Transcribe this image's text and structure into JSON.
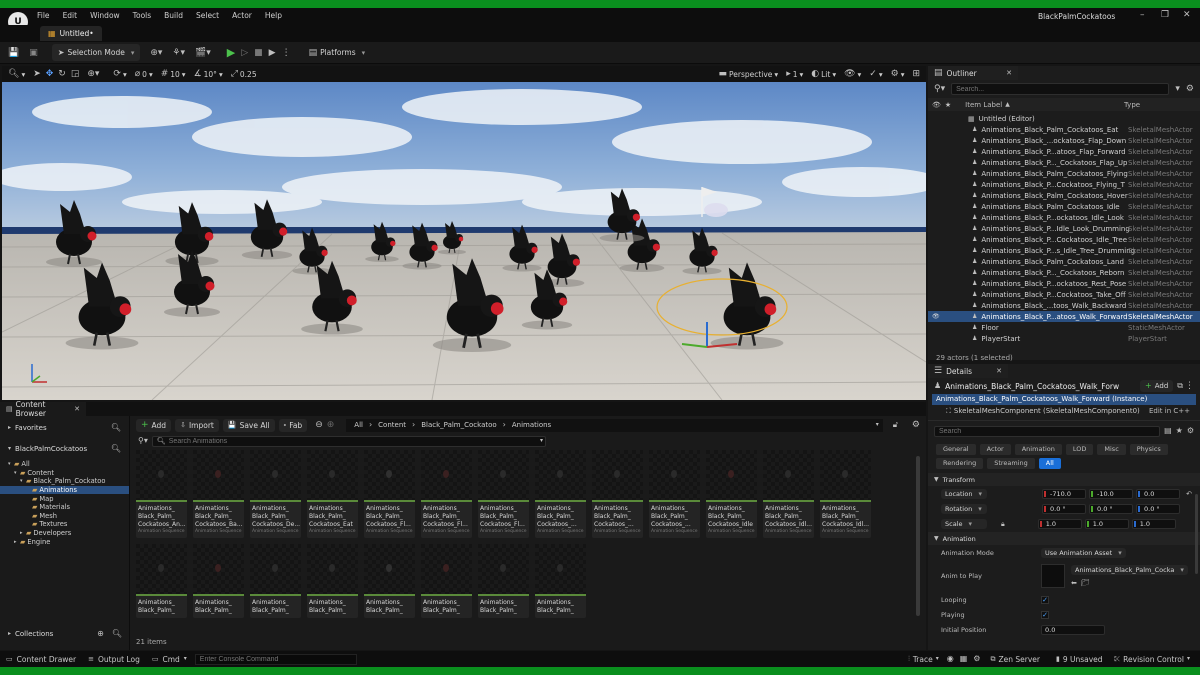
{
  "app": {
    "project_name": "BlackPalmCockatoos",
    "tab_label": "Untitled•"
  },
  "menu": [
    "File",
    "Edit",
    "Window",
    "Tools",
    "Build",
    "Select",
    "Actor",
    "Help"
  ],
  "toolbar": {
    "selection_mode": "Selection Mode",
    "platforms": "Platforms"
  },
  "viewport": {
    "perspective": "Perspective",
    "lit": "Lit",
    "view_count": "1",
    "rotation_snap_value": "0",
    "grid_snap": "10",
    "angle_snap": "10°",
    "scale_snap": "0.25"
  },
  "outliner": {
    "title": "Outliner",
    "search_placeholder": "Search...",
    "col_label": "Item Label",
    "col_type": "Type",
    "root": "Untitled (Editor)",
    "items": [
      {
        "label": "Animations_Black_Palm_Cockatoos_Eat",
        "type": "SkeletalMeshActor"
      },
      {
        "label": "Animations_Black_...ockatoos_Flap_Down",
        "type": "SkeletalMeshActor"
      },
      {
        "label": "Animations_Black_P...atoos_Flap_Forward",
        "type": "SkeletalMeshActor"
      },
      {
        "label": "Animations_Black_P..._Cockatoos_Flap_Up",
        "type": "SkeletalMeshActor"
      },
      {
        "label": "Animations_Black_Palm_Cockatoos_Flying",
        "type": "SkeletalMeshActor"
      },
      {
        "label": "Animations_Black_P...Cockatoos_Flying_T",
        "type": "SkeletalMeshActor"
      },
      {
        "label": "Animations_Black_Palm_Cockatoos_Hover",
        "type": "SkeletalMeshActor"
      },
      {
        "label": "Animations_Black_Palm_Cockatoos_Idle",
        "type": "SkeletalMeshActor"
      },
      {
        "label": "Animations_Black_P...ockatoos_Idle_Look",
        "type": "SkeletalMeshActor"
      },
      {
        "label": "Animations_Black_P...Idle_Look_Drumming",
        "type": "SkeletalMeshActor"
      },
      {
        "label": "Animations_Black_P...Cockatoos_Idle_Tree",
        "type": "SkeletalMeshActor"
      },
      {
        "label": "Animations_Black_P...s_Idle_Tree_Drumming",
        "type": "SkeletalMeshActor"
      },
      {
        "label": "Animations_Black_Palm_Cockatoos_Land",
        "type": "SkeletalMeshActor"
      },
      {
        "label": "Animations_Black_P..._Cockatoos_Reborn",
        "type": "SkeletalMeshActor"
      },
      {
        "label": "Animations_Black_P...ockatoos_Rest_Pose",
        "type": "SkeletalMeshActor"
      },
      {
        "label": "Animations_Black_P...Cockatoos_Take_Off",
        "type": "SkeletalMeshActor"
      },
      {
        "label": "Animations_Black_...toos_Walk_Backward",
        "type": "SkeletalMeshActor"
      },
      {
        "label": "Animations_Black_P...atoos_Walk_Forward",
        "type": "SkeletalMeshActor",
        "selected": true
      },
      {
        "label": "Floor",
        "type": "StaticMeshActor"
      },
      {
        "label": "PlayerStart",
        "type": "PlayerStart"
      }
    ],
    "footer": "29 actors (1 selected)"
  },
  "details": {
    "title": "Details",
    "actor_name": "Animations_Black_Palm_Cockatoos_Walk_Forw",
    "add_label": "Add",
    "instance": "Animations_Black_Palm_Cockatoos_Walk_Forward (Instance)",
    "component": "SkeletalMeshComponent (SkeletalMeshComponent0)",
    "edit_cpp": "Edit in C++",
    "search_placeholder": "Search",
    "chips": [
      "General",
      "Actor",
      "Animation",
      "LOD",
      "Misc",
      "Physics",
      "Rendering",
      "Streaming",
      "All"
    ],
    "transform_header": "Transform",
    "location": {
      "label": "Location",
      "x": "-710.0",
      "y": "-10.0",
      "z": "0.0"
    },
    "rotation": {
      "label": "Rotation",
      "x": "0.0 °",
      "y": "0.0 °",
      "z": "0.0 °"
    },
    "scale": {
      "label": "Scale",
      "x": "1.0",
      "y": "1.0",
      "z": "1.0"
    },
    "animation_header": "Animation",
    "animation_mode_label": "Animation Mode",
    "animation_mode_value": "Use Animation Asset",
    "anim_to_play_label": "Anim to Play",
    "anim_to_play_value": "Animations_Black_Palm_Cocka",
    "looping_label": "Looping",
    "playing_label": "Playing",
    "initial_position_label": "Initial Position",
    "initial_position_value": "0.0"
  },
  "content_browser": {
    "title": "Content Browser",
    "favorites": "Favorites",
    "project": "BlackPalmCockatoos",
    "collections": "Collections",
    "add": "Add",
    "import": "Import",
    "save_all": "Save All",
    "fab": "Fab",
    "path": [
      "All",
      "Content",
      "Black_Palm_Cockatoo",
      "Animations"
    ],
    "search_placeholder": "Search Animations",
    "item_count": "21 items",
    "tree": [
      {
        "label": "All",
        "depth": 0
      },
      {
        "label": "Content",
        "depth": 1
      },
      {
        "label": "Black_Palm_Cockatoo",
        "depth": 2
      },
      {
        "label": "Animations",
        "depth": 3,
        "selected": true
      },
      {
        "label": "Map",
        "depth": 3
      },
      {
        "label": "Materials",
        "depth": 3
      },
      {
        "label": "Mesh",
        "depth": 3
      },
      {
        "label": "Textures",
        "depth": 3
      },
      {
        "label": "Developers",
        "depth": 2
      },
      {
        "label": "Engine",
        "depth": 1
      }
    ],
    "assets_row1": [
      "Animations_\nBlack_Palm_\nCockatoos_An...",
      "Animations_\nBlack_Palm_\nCockatoos_Ba...",
      "Animations_\nBlack_Palm_\nCockatoos_De...",
      "Animations_\nBlack_Palm_\nCockatoos_Eat",
      "Animations_\nBlack_Palm_\nCockatoos_Fl...",
      "Animations_\nBlack_Palm_\nCockatoos_Fl...",
      "Animations_\nBlack_Palm_\nCockatoos_Fl...",
      "Animations_\nBlack_Palm_\nCockatoos_...",
      "Animations_\nBlack_Palm_\nCockatoos_...",
      "Animations_\nBlack_Palm_\nCockatoos_...",
      "Animations_\nBlack_Palm_\nCockatoos_Idle",
      "Animations_\nBlack_Palm_\nCockatoos_Idl...",
      "Animations_\nBlack_Palm_\nCockatoos_Idl..."
    ],
    "assets_row2": [
      "Animations_\nBlack_Palm_",
      "Animations_\nBlack_Palm_",
      "Animations_\nBlack_Palm_",
      "Animations_\nBlack_Palm_",
      "Animations_\nBlack_Palm_",
      "Animations_\nBlack_Palm_",
      "Animations_\nBlack_Palm_",
      "Animations_\nBlack_Palm_"
    ],
    "asset_type": "Animation Sequence"
  },
  "statusbar": {
    "content_drawer": "Content Drawer",
    "output_log": "Output Log",
    "cmd": "Cmd",
    "console_placeholder": "Enter Console Command",
    "trace": "Trace",
    "zen": "Zen Server",
    "unsaved": "9 Unsaved",
    "revision": "Revision Control"
  }
}
